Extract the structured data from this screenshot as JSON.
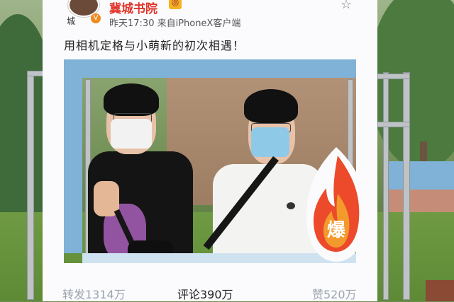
{
  "post": {
    "avatar_caption": "城",
    "verified_badge": "V",
    "username": "冀城书院",
    "username_badge": "😻",
    "meta": "昨天17:30  来自iPhoneX客户端",
    "favorite_icon": "☆",
    "caption": "用相机定格与小萌新的初次相遇！"
  },
  "stats": {
    "repost": "转发1314万",
    "comment": "评论390万",
    "like": "赞520万"
  },
  "sticker": {
    "label": "爆",
    "colors": {
      "flame_outer": "#ec4a2a",
      "flame_inner": "#f39a2c",
      "text": "#ffffff"
    }
  },
  "colors": {
    "frame_white": "#fbfbfd",
    "frame_blue": "#7fb2d6",
    "username_red": "#e0352b"
  }
}
